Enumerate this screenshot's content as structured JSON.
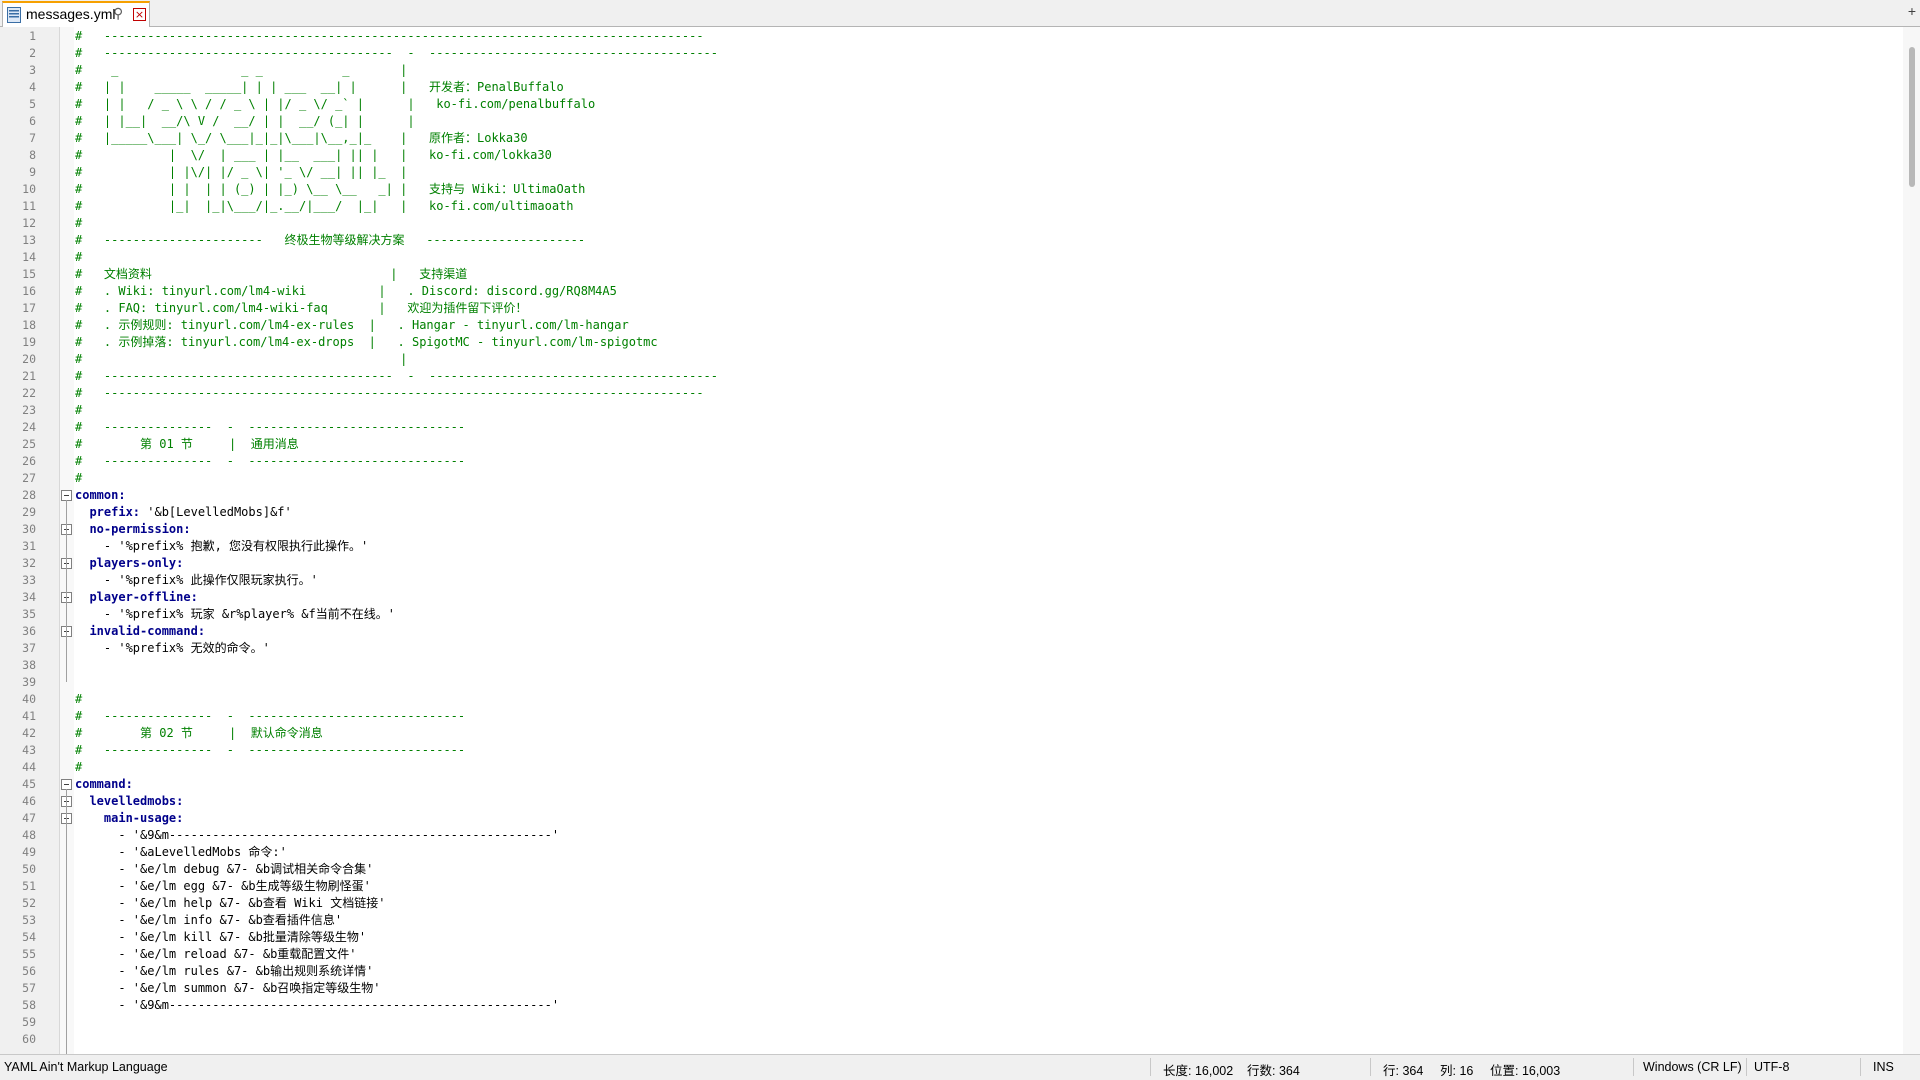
{
  "tab": {
    "filename": "messages.yml",
    "pin_glyph": "⚲",
    "close_glyph": "×",
    "extra_glyph": "+"
  },
  "colors": {
    "comment": "#008000",
    "key": "#00008b",
    "text": "#000000",
    "line_number": "#808080",
    "tab_accent": "#f6a000"
  },
  "lines": [
    {
      "n": "1",
      "text": "#   -----------------------------------------------------------------------------------",
      "kind": "comment"
    },
    {
      "n": "2",
      "text": "#   ----------------------------------------  -  ----------------------------------------",
      "kind": "comment"
    },
    {
      "n": "3",
      "text": "#    _                 _ _           _       |",
      "kind": "comment"
    },
    {
      "n": "4",
      "text": "#   | |    _____  _____| | | ___  __| |      |   开发者：PenalBuffalo",
      "kind": "comment"
    },
    {
      "n": "5",
      "text": "#   | |   / _ \\ \\ / / _ \\ | |/ _ \\/ _` |      |   ko-fi.com/penalbuffalo",
      "kind": "comment"
    },
    {
      "n": "6",
      "text": "#   | |__|  __/\\ V /  __/ | |  __/ (_| |      |",
      "kind": "comment"
    },
    {
      "n": "7",
      "text": "#   |_____\\___| \\_/ \\___|_|_|\\___|\\__,_|_    |   原作者：Lokka30",
      "kind": "comment"
    },
    {
      "n": "8",
      "text": "#            |  \\/  | ___ | |__  ___| || |   |   ko-fi.com/lokka30",
      "kind": "comment"
    },
    {
      "n": "9",
      "text": "#            | |\\/| |/ _ \\| '_ \\/ __| || |_  |",
      "kind": "comment"
    },
    {
      "n": "10",
      "text": "#            | |  | | (_) | |_) \\__ \\__   _| |   支持与 Wiki：UltimaOath",
      "kind": "comment"
    },
    {
      "n": "11",
      "text": "#            |_|  |_|\\___/|_.__/|___/  |_|   |   ko-fi.com/ultimaoath",
      "kind": "comment"
    },
    {
      "n": "12",
      "text": "#",
      "kind": "comment"
    },
    {
      "n": "13",
      "text": "#   ----------------------   终极生物等级解决方案   ----------------------",
      "kind": "comment"
    },
    {
      "n": "14",
      "text": "#",
      "kind": "comment"
    },
    {
      "n": "15",
      "text": "#   文档资料                                 |   支持渠道",
      "kind": "comment"
    },
    {
      "n": "16",
      "text": "#   . Wiki: tinyurl.com/lm4-wiki          |   . Discord: discord.gg/RQ8M4A5",
      "kind": "comment"
    },
    {
      "n": "17",
      "text": "#   . FAQ: tinyurl.com/lm4-wiki-faq       |   欢迎为插件留下评价！",
      "kind": "comment"
    },
    {
      "n": "18",
      "text": "#   . 示例规则: tinyurl.com/lm4-ex-rules  |   . Hangar - tinyurl.com/lm-hangar",
      "kind": "comment"
    },
    {
      "n": "19",
      "text": "#   . 示例掉落: tinyurl.com/lm4-ex-drops  |   . SpigotMC - tinyurl.com/lm-spigotmc",
      "kind": "comment"
    },
    {
      "n": "20",
      "text": "#                                            |",
      "kind": "comment"
    },
    {
      "n": "21",
      "text": "#   ----------------------------------------  -  ----------------------------------------",
      "kind": "comment"
    },
    {
      "n": "22",
      "text": "#   -----------------------------------------------------------------------------------",
      "kind": "comment"
    },
    {
      "n": "23",
      "text": "#",
      "kind": "comment"
    },
    {
      "n": "24",
      "text": "#   ---------------  -  ------------------------------",
      "kind": "comment"
    },
    {
      "n": "25",
      "text": "#        第 01 节     |  通用消息",
      "kind": "comment"
    },
    {
      "n": "26",
      "text": "#   ---------------  -  ------------------------------",
      "kind": "comment"
    },
    {
      "n": "27",
      "text": "#",
      "kind": "comment"
    },
    {
      "n": "28",
      "text": "common:",
      "kind": "key"
    },
    {
      "n": "29",
      "text": "  prefix: '&b[LevelledMobs]&f'",
      "kind": "mixed",
      "key": "  prefix:",
      "val": " '&b[LevelledMobs]&f'"
    },
    {
      "n": "30",
      "text": "  no-permission:",
      "kind": "key"
    },
    {
      "n": "31",
      "text": "    - '%prefix% 抱歉, 您没有权限执行此操作。'",
      "kind": "plain"
    },
    {
      "n": "32",
      "text": "  players-only:",
      "kind": "key"
    },
    {
      "n": "33",
      "text": "    - '%prefix% 此操作仅限玩家执行。'",
      "kind": "plain"
    },
    {
      "n": "34",
      "text": "  player-offline:",
      "kind": "key"
    },
    {
      "n": "35",
      "text": "    - '%prefix% 玩家 &r%player% &f当前不在线。'",
      "kind": "plain"
    },
    {
      "n": "36",
      "text": "  invalid-command:",
      "kind": "key"
    },
    {
      "n": "37",
      "text": "    - '%prefix% 无效的命令。'",
      "kind": "plain"
    },
    {
      "n": "38",
      "text": "",
      "kind": "plain"
    },
    {
      "n": "39",
      "text": "",
      "kind": "plain"
    },
    {
      "n": "40",
      "text": "#",
      "kind": "comment"
    },
    {
      "n": "41",
      "text": "#   ---------------  -  ------------------------------",
      "kind": "comment"
    },
    {
      "n": "42",
      "text": "#        第 02 节     |  默认命令消息",
      "kind": "comment"
    },
    {
      "n": "43",
      "text": "#   ---------------  -  ------------------------------",
      "kind": "comment"
    },
    {
      "n": "44",
      "text": "#",
      "kind": "comment"
    },
    {
      "n": "45",
      "text": "command:",
      "kind": "key"
    },
    {
      "n": "46",
      "text": "  levelledmobs:",
      "kind": "key"
    },
    {
      "n": "47",
      "text": "    main-usage:",
      "kind": "key"
    },
    {
      "n": "48",
      "text": "      - '&9&m-----------------------------------------------------'",
      "kind": "plain"
    },
    {
      "n": "49",
      "text": "      - '&aLevelledMobs 命令:'",
      "kind": "plain"
    },
    {
      "n": "50",
      "text": "      - '&e/lm debug &7- &b调试相关命令合集'",
      "kind": "plain"
    },
    {
      "n": "51",
      "text": "      - '&e/lm egg &7- &b生成等级生物刷怪蛋'",
      "kind": "plain"
    },
    {
      "n": "52",
      "text": "      - '&e/lm help &7- &b查看 Wiki 文档链接'",
      "kind": "plain"
    },
    {
      "n": "53",
      "text": "      - '&e/lm info &7- &b查看插件信息'",
      "kind": "plain"
    },
    {
      "n": "54",
      "text": "      - '&e/lm kill &7- &b批量清除等级生物'",
      "kind": "plain"
    },
    {
      "n": "55",
      "text": "      - '&e/lm reload &7- &b重载配置文件'",
      "kind": "plain"
    },
    {
      "n": "56",
      "text": "      - '&e/lm rules &7- &b输出规则系统详情'",
      "kind": "plain"
    },
    {
      "n": "57",
      "text": "      - '&e/lm summon &7- &b召唤指定等级生物'",
      "kind": "plain"
    },
    {
      "n": "58",
      "text": "      - '&9&m-----------------------------------------------------'",
      "kind": "plain"
    },
    {
      "n": "59",
      "text": "",
      "kind": "plain"
    },
    {
      "n": "60",
      "text": "",
      "kind": "plain"
    }
  ],
  "fold_markers": [
    "28",
    "30",
    "32",
    "34",
    "36",
    "45",
    "46",
    "47"
  ],
  "status": {
    "language": "YAML Ain't Markup Language",
    "length": "长度: 16,002",
    "lines": "行数: 364",
    "line": "行: 364",
    "col": "列: 16",
    "pos": "位置: 16,003",
    "eol": "Windows (CR LF)",
    "encoding": "UTF-8",
    "mode": "INS"
  }
}
